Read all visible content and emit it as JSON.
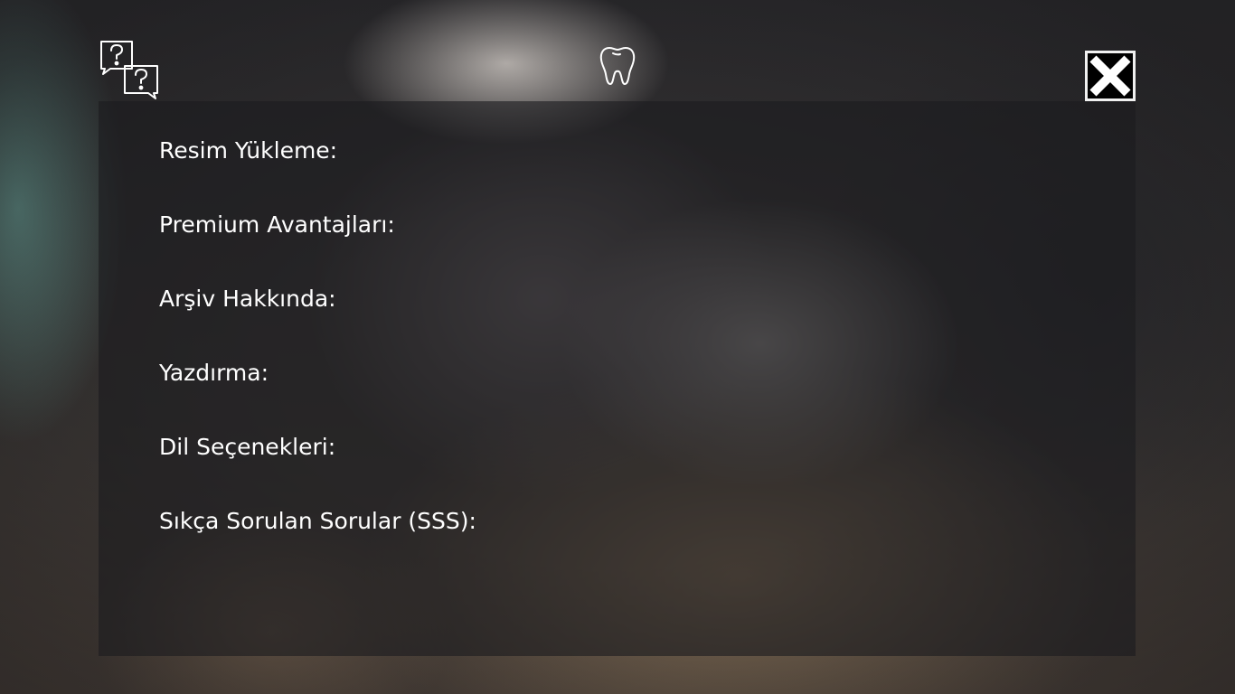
{
  "header": {
    "help_icon": "help-questions-icon",
    "logo_icon": "tooth-icon",
    "close_icon": "close-icon"
  },
  "faq": {
    "items": [
      {
        "label": "Resim Yükleme:"
      },
      {
        "label": "Premium Avantajları:"
      },
      {
        "label": "Arşiv Hakkında:"
      },
      {
        "label": "Yazdırma:"
      },
      {
        "label": "Dil Seçenekleri:"
      },
      {
        "label": "Sıkça Sorulan Sorular (SSS):"
      }
    ]
  },
  "colors": {
    "text": "#ffffff",
    "panel": "#1c1c1e",
    "close_bg": "#000000",
    "close_fg": "#ffffff"
  }
}
